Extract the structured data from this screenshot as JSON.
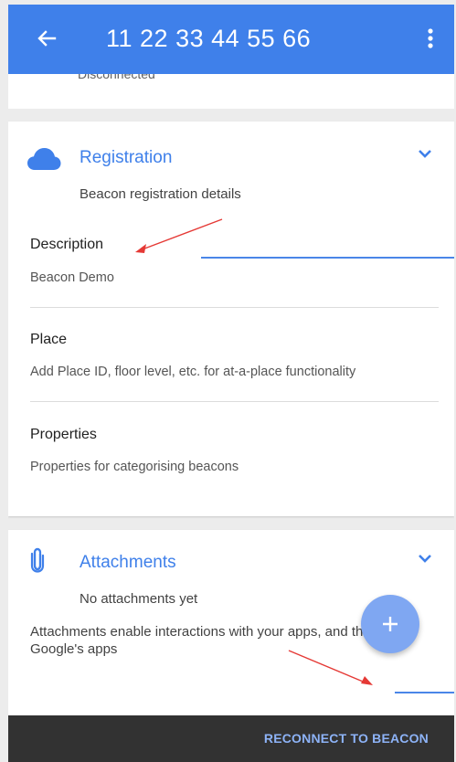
{
  "appbar": {
    "title": "11 22 33 44 55 66",
    "back_icon": "arrow-left-icon",
    "menu_icon": "more-vert-icon"
  },
  "top_card": {
    "status": "Disconnected"
  },
  "registration": {
    "title": "Registration",
    "subtitle": "Beacon registration details",
    "icon": "cloud-icon",
    "fields": [
      {
        "label": "Description",
        "value": "Beacon Demo"
      },
      {
        "label": "Place",
        "value": "Add Place ID, floor level, etc. for at-a-place functionality"
      },
      {
        "label": "Properties",
        "value": "Properties for categorising beacons"
      }
    ]
  },
  "attachments": {
    "title": "Attachments",
    "subtitle": "No attachments yet",
    "description": "Attachments enable interactions with your apps, and through Google's apps",
    "icon": "paperclip-icon"
  },
  "fab": {
    "icon": "plus-icon"
  },
  "snackbar": {
    "action": "RECONNECT TO BEACON"
  },
  "colors": {
    "primary": "#3f80ea",
    "fab": "#7fa7f2",
    "bottom_bar": "#323232",
    "annotation": "#e53935"
  }
}
